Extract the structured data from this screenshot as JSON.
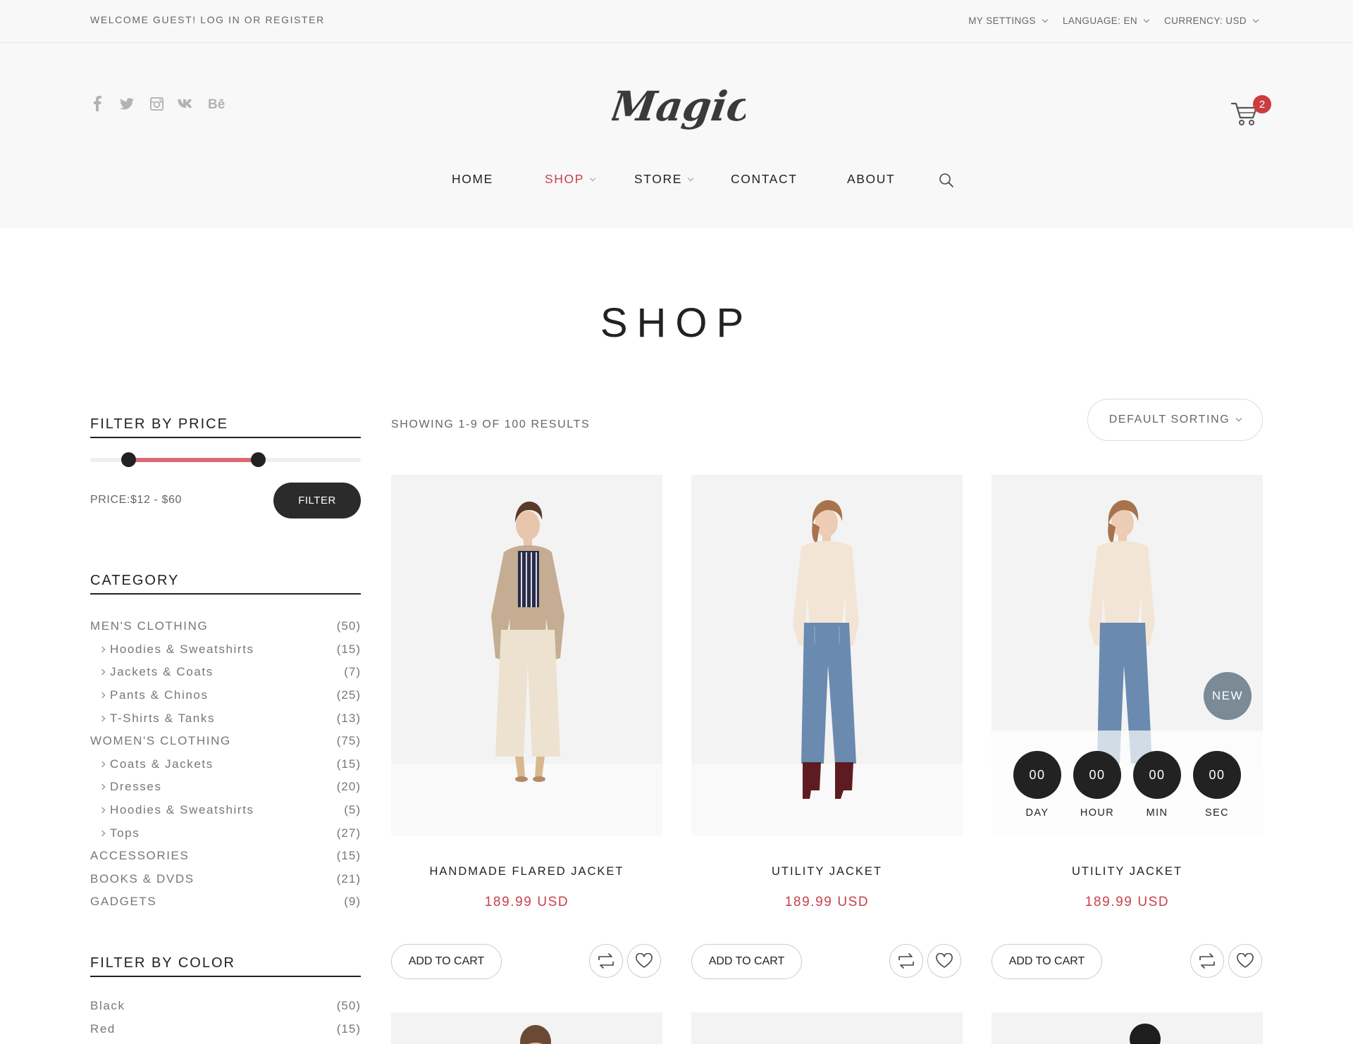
{
  "topbar": {
    "welcome": "WELCOME GUEST! LOG IN OR REGISTER",
    "settings": "MY SETTINGS",
    "language": "LANGUAGE: EN",
    "currency": "CURRENCY: USD"
  },
  "header": {
    "logo_text": "Magic",
    "social": [
      {
        "icon": "facebook-icon",
        "glyph": "f"
      },
      {
        "icon": "twitter-icon",
        "glyph": ""
      },
      {
        "icon": "instagram-icon",
        "glyph": ""
      },
      {
        "icon": "vk-icon",
        "glyph": "vk"
      },
      {
        "icon": "behance-icon",
        "glyph": "Bē"
      }
    ],
    "cart_count": "2"
  },
  "nav": {
    "home": "HOME",
    "shop": "SHOP",
    "store": "STORE",
    "contact": "CONTACT",
    "about": "ABOUT"
  },
  "page": {
    "title": "SHOP"
  },
  "sidebar": {
    "price_heading": "FILTER BY PRICE",
    "price_range_text": "PRICE:$12 - $60",
    "price_min_fraction": 0.14,
    "price_max_fraction": 0.62,
    "filter_button": "FILTER",
    "category_heading": "CATEGORY",
    "categories": [
      {
        "label": "MEN'S CLOTHING",
        "count": "(50)",
        "sub": false
      },
      {
        "label": "Hoodies & Sweatshirts",
        "count": "(15)",
        "sub": true
      },
      {
        "label": "Jackets & Coats",
        "count": "(7)",
        "sub": true
      },
      {
        "label": "Pants & Chinos",
        "count": "(25)",
        "sub": true
      },
      {
        "label": "T-Shirts & Tanks",
        "count": "(13)",
        "sub": true
      },
      {
        "label": "WOMEN'S CLOTHING",
        "count": "(75)",
        "sub": false
      },
      {
        "label": "Coats & Jackets",
        "count": "(15)",
        "sub": true
      },
      {
        "label": "Dresses",
        "count": "(20)",
        "sub": true
      },
      {
        "label": "Hoodies & Sweatshirts",
        "count": "(5)",
        "sub": true
      },
      {
        "label": "Tops",
        "count": "(27)",
        "sub": true
      },
      {
        "label": "ACCESSORIES",
        "count": "(15)",
        "sub": false
      },
      {
        "label": "BOOKS & DVDS",
        "count": "(21)",
        "sub": false
      },
      {
        "label": "GADGETS",
        "count": "(9)",
        "sub": false
      }
    ],
    "color_heading": "FILTER BY COLOR",
    "colors": [
      {
        "label": "Black",
        "count": "(50)"
      },
      {
        "label": "Red",
        "count": "(15)"
      }
    ]
  },
  "toolbar": {
    "results_text": "SHOWING 1-9 OF 100 RESULTS",
    "sort_label": "DEFAULT SORTING"
  },
  "products": [
    {
      "name": "HANDMADE FLARED JACKET",
      "price": "189.99 USD",
      "add_to_cart": "ADD TO CART",
      "badge": "",
      "countdown": null
    },
    {
      "name": "UTILITY JACKET",
      "price": "189.99 USD",
      "add_to_cart": "ADD TO CART",
      "badge": "",
      "countdown": null
    },
    {
      "name": "UTILITY JACKET",
      "price": "189.99 USD",
      "add_to_cart": "ADD TO CART",
      "badge": "NEW",
      "countdown": [
        {
          "value": "00",
          "unit": "DAY"
        },
        {
          "value": "00",
          "unit": "HOUR"
        },
        {
          "value": "00",
          "unit": "MIN"
        },
        {
          "value": "00",
          "unit": "SEC"
        }
      ]
    }
  ],
  "colors": {
    "accent": "#c6414a",
    "dark": "#222222",
    "badge_new": "#7a8a97",
    "cart_badge": "#cc3b40",
    "slider_range": "#d96b73"
  }
}
